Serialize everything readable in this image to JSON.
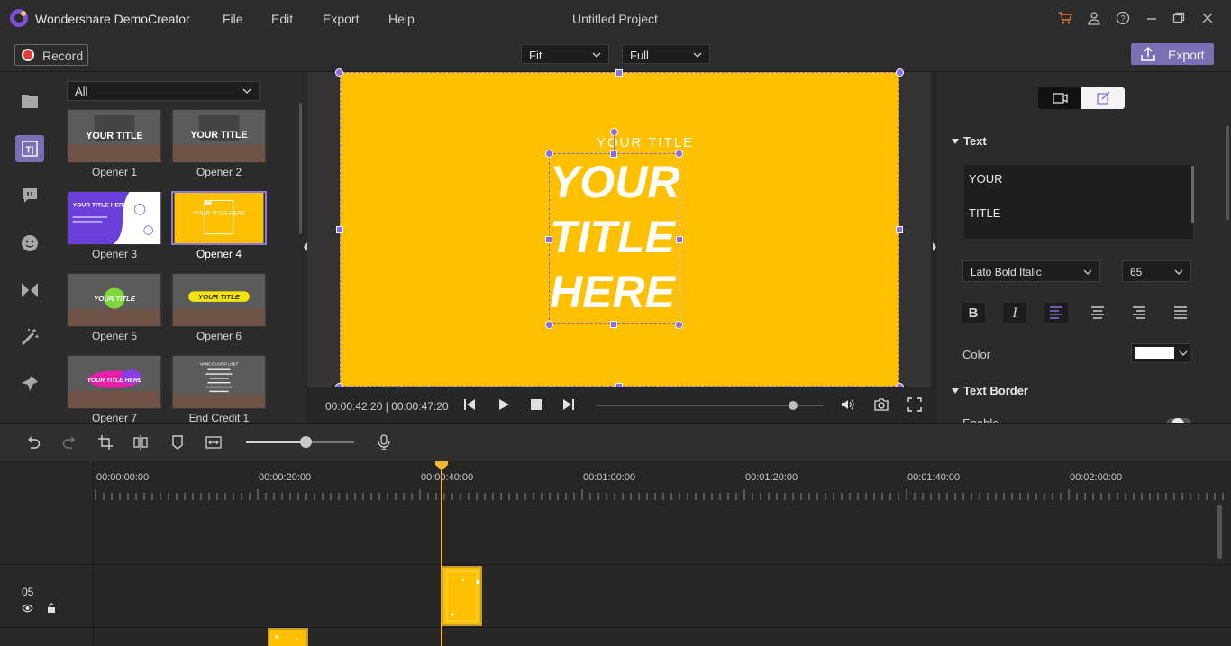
{
  "app": {
    "name": "Wondershare DemoCreator",
    "menu": [
      "File",
      "Edit",
      "Export",
      "Help"
    ],
    "project_title": "Untitled Project"
  },
  "toolbar": {
    "record_label": "Record",
    "fit_value": "Fit",
    "quality_value": "Full",
    "export_label": "Export"
  },
  "library": {
    "filter_value": "All",
    "items": [
      {
        "label": "Opener 1",
        "thumb_text": "YOUR TITLE"
      },
      {
        "label": "Opener 2",
        "thumb_text": "YOUR TITLE"
      },
      {
        "label": "Opener 3",
        "thumb_text": "YOUR TITLE HERE"
      },
      {
        "label": "Opener 4",
        "thumb_text": "YOUR TITLE HERE"
      },
      {
        "label": "Opener 5",
        "thumb_text": "YOUR TITLE"
      },
      {
        "label": "Opener 6",
        "thumb_text": "YOUR TITLE"
      },
      {
        "label": "Opener 7",
        "thumb_text": "YOUR TITLE HERE"
      },
      {
        "label": "End Credit 1",
        "thumb_text": "VANCOUVER UNIT"
      }
    ],
    "selected_index": 3
  },
  "preview": {
    "small_title": "YOUR TITLE",
    "big_title_lines": [
      "YOUR",
      "TITLE",
      "HERE"
    ],
    "canvas_color": "#ffc000",
    "timecode_current": "00:00:42:20",
    "timecode_total": "00:00:47:20",
    "progress": 0.87
  },
  "properties": {
    "text_section_title": "Text",
    "text_lines": [
      "YOUR",
      "TITLE"
    ],
    "font_family": "Lato Bold Italic",
    "font_size": "65",
    "color_label": "Color",
    "color_value": "#ffffff",
    "border_section_title": "Text Border",
    "enable_label": "Enable"
  },
  "timeline": {
    "ruler_labels": [
      "00:00:00:00",
      "00:00:20:00",
      "00:00:40:00",
      "00:01:00:00",
      "00:01:20:00",
      "00:01:40:00",
      "00:02:00:00"
    ],
    "track_label": "05",
    "zoom": 0.55
  },
  "colors": {
    "accent": "#7a6fb4",
    "playhead": "#f5b731",
    "clip": "#ffc000"
  }
}
